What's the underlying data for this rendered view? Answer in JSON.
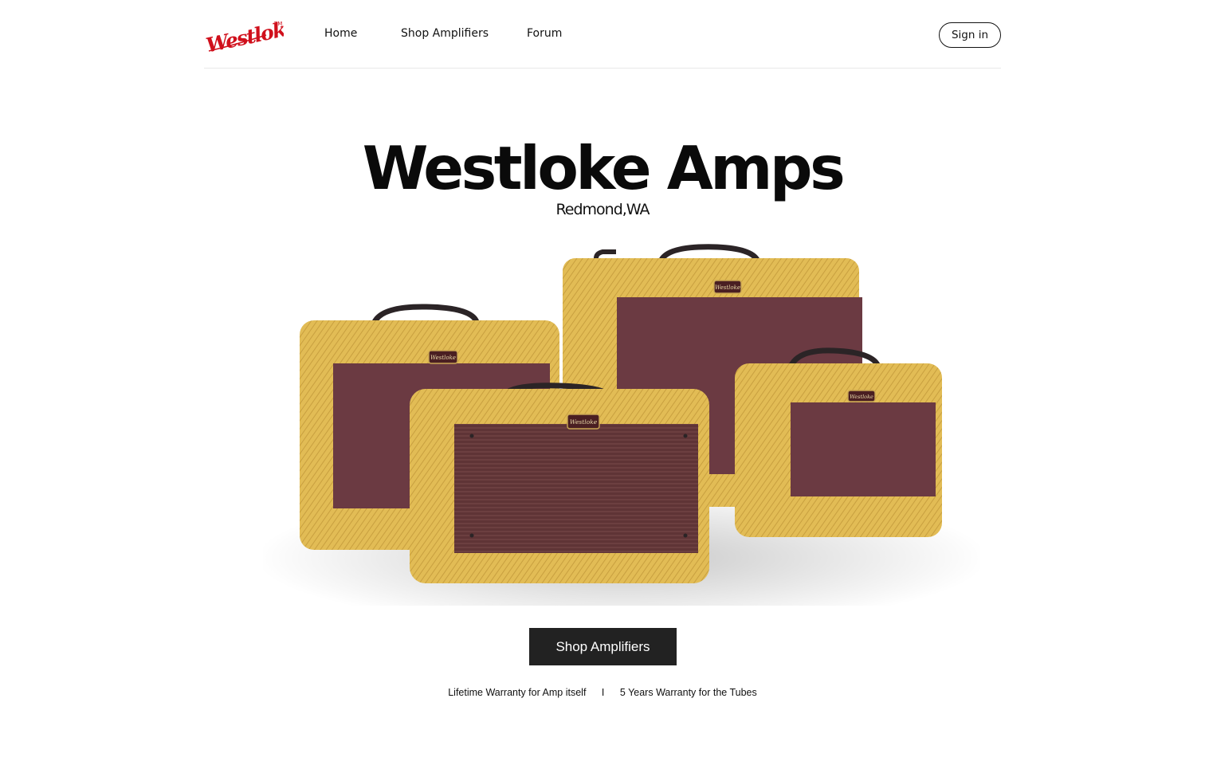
{
  "brand": {
    "logo_text": "Westloke",
    "trademark": "TM",
    "color": "#d0101c"
  },
  "nav": {
    "items": [
      {
        "label": "Home"
      },
      {
        "label": "Shop Amplifiers"
      },
      {
        "label": "Forum"
      }
    ],
    "sign_in_label": "Sign in"
  },
  "hero": {
    "title": "Westloke Amps",
    "subtitle": "Redmond,WA",
    "image_alt": "four tweed guitar amplifiers",
    "amp_badge_text": "Westloke",
    "cta_label": "Shop Amplifiers"
  },
  "warranty": {
    "left": "Lifetime Warranty for Amp itself",
    "separator": "I",
    "right": "5 Years Warranty for the Tubes"
  },
  "colors": {
    "tweed": "#e2bc55",
    "grille": "#6b3a42",
    "button_dark": "#222222"
  }
}
